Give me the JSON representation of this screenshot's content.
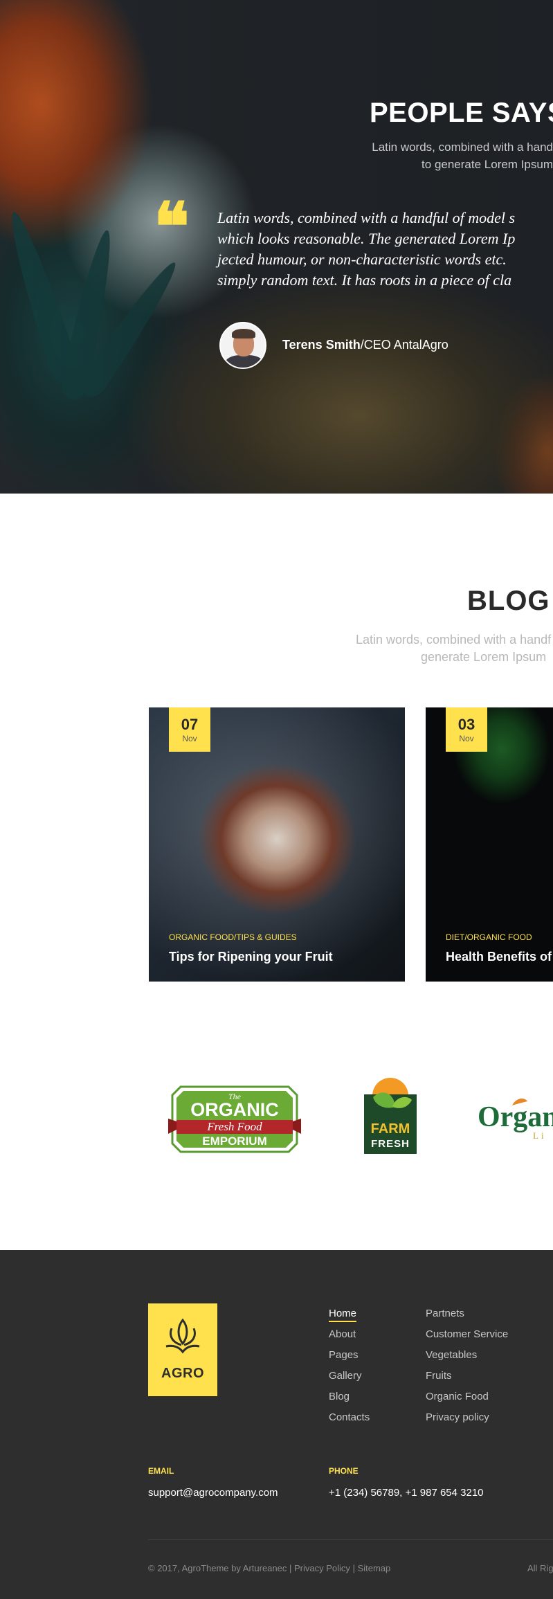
{
  "testimonial": {
    "heading": "PEOPLE SAYS",
    "subtitle_lines": [
      "Latin words, combined with a hand",
      "to generate Lorem Ipsum"
    ],
    "quote_lines": [
      "Latin words, combined with a handful of model s",
      "which looks reasonable. The generated Lorem Ip",
      "jected humour, or non-characteristic words etc.",
      "simply random text. It has roots in a piece of cla"
    ],
    "author_name": "Terens Smith",
    "author_role": "/CEO AntalAgro",
    "quote_icon": "quote-icon"
  },
  "blog": {
    "heading": "BLOG",
    "subtitle_lines": [
      "Latin words, combined with a handf",
      "generate Lorem Ipsum"
    ],
    "posts": [
      {
        "day": "07",
        "month": "Nov",
        "category": "ORGANIC FOOD/TIPS & GUIDES",
        "title": "Tips for Ripening your Fruit"
      },
      {
        "day": "03",
        "month": "Nov",
        "category": "DIET/ORGANIC FOOD",
        "title": "Health Benefits of"
      }
    ]
  },
  "partners": {
    "organic": {
      "small": "The",
      "title": "ORGANIC",
      "banner": "Fresh Food",
      "bottom": "EMPORIUM"
    },
    "farm": {
      "line1": "FARM",
      "line2": "FRESH"
    },
    "third": {
      "text": "Organ",
      "small": "Li"
    }
  },
  "footer": {
    "logo_text": "AGRO",
    "logo_icon": "plant-icon",
    "menu1": [
      "Home",
      "About",
      "Pages",
      "Gallery",
      "Blog",
      "Contacts"
    ],
    "menu2": [
      "Partnets",
      "Customer Service",
      "Vegetables",
      "Fruits",
      "Organic Food",
      "Privacy policy"
    ],
    "email_label": "EMAIL",
    "email": "support@agrocompany.com",
    "phone_label": "PHONE",
    "phone": "+1 (234) 56789,  +1 987 654 3210",
    "copyright": "© 2017, AgroTheme by Artureanec",
    "privacy_link": "Privacy Policy",
    "sitemap_link": "Sitemap",
    "separator": "|",
    "rights": "All Rig"
  },
  "colors": {
    "accent": "#ffe14d",
    "footer_bg": "#2e2e2e",
    "dark_bg": "#23272b"
  }
}
